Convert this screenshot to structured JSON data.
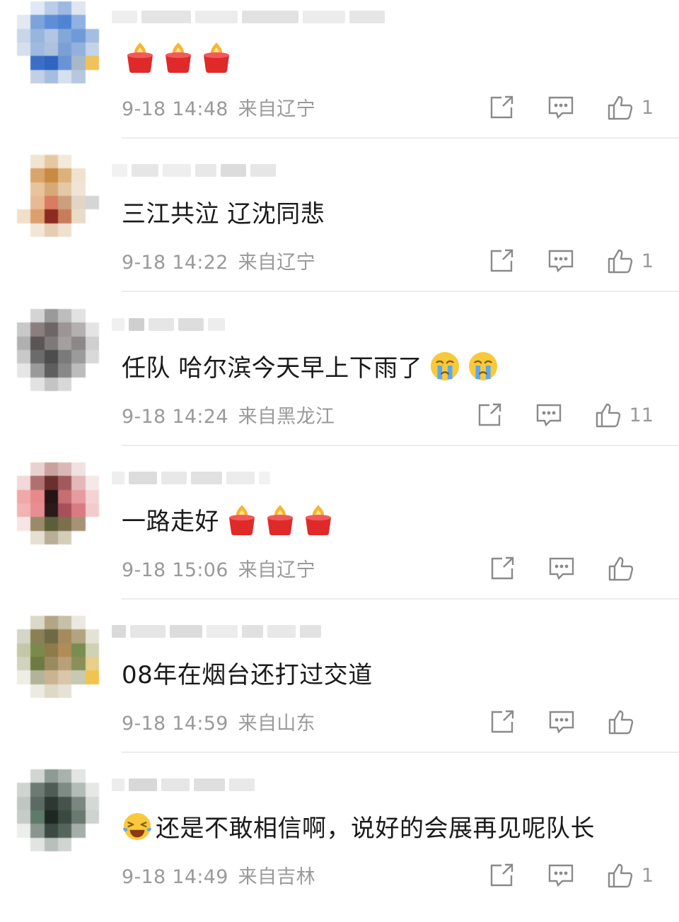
{
  "comments": [
    {
      "text": "",
      "emojis": [
        "candle",
        "candle",
        "candle"
      ],
      "date": "9-18 14:48",
      "location": "来自辽宁",
      "likes": "1"
    },
    {
      "text": "三江共泣 辽沈同悲",
      "emojis": [],
      "date": "9-18 14:22",
      "location": "来自辽宁",
      "likes": "1"
    },
    {
      "text": "任队 哈尔滨今天早上下雨了",
      "emojis": [
        "crying-face",
        "crying-face"
      ],
      "date": "9-18 14:24",
      "location": "来自黑龙江",
      "likes": "11"
    },
    {
      "text": "一路走好",
      "emojis": [
        "candle",
        "candle",
        "candle"
      ],
      "date": "9-18 15:06",
      "location": "来自辽宁",
      "likes": ""
    },
    {
      "text": "08年在烟台还打过交道",
      "emojis": [],
      "date": "9-18 14:59",
      "location": "来自山东",
      "likes": ""
    },
    {
      "text": "还是不敢相信啊，说好的会展再见呢队长",
      "emojis": [],
      "leading_emoji": "laughing-crying-face",
      "date": "9-18 14:49",
      "location": "来自吉林",
      "likes": "1"
    }
  ],
  "icons": {
    "share": "share-icon",
    "reply": "comment-icon",
    "like": "thumbs-up-icon"
  },
  "colors": {
    "meta_gray": "#9a9a9a",
    "text": "#1a1a1a",
    "divider": "#ececec",
    "candle_red": "#e02a2a"
  }
}
